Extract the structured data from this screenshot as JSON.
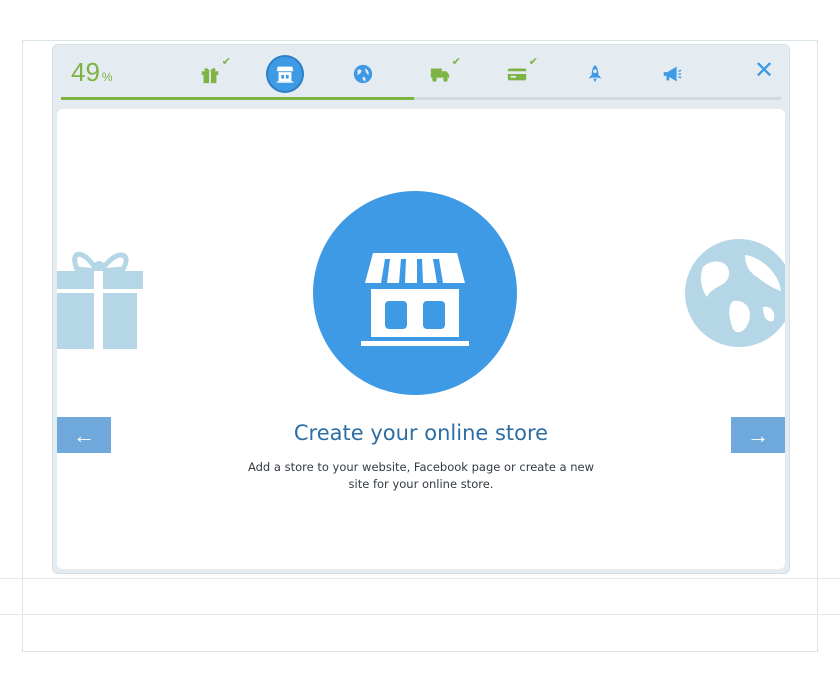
{
  "progress": {
    "value": "49",
    "unit": "%",
    "fraction": 0.49
  },
  "steps": [
    {
      "icon": "gift-icon",
      "completed": true,
      "active": false
    },
    {
      "icon": "store-icon",
      "completed": false,
      "active": true
    },
    {
      "icon": "globe-icon",
      "completed": false,
      "active": false
    },
    {
      "icon": "delivery-truck-icon",
      "completed": true,
      "active": false
    },
    {
      "icon": "payment-card-icon",
      "completed": true,
      "active": false
    },
    {
      "icon": "rocket-icon",
      "completed": false,
      "active": false
    },
    {
      "icon": "megaphone-icon",
      "completed": false,
      "active": false
    }
  ],
  "close_glyph": "✕",
  "slide": {
    "title": "Create your online store",
    "description": "Add a store to your website, Facebook page or create a new site for your online store."
  },
  "nav": {
    "prev_glyph": "←",
    "next_glyph": "→"
  },
  "colors": {
    "accent": "#3f9ae5",
    "progress": "#7cb342",
    "check": "#7cb342",
    "side_icon": "#b4d6e6"
  }
}
